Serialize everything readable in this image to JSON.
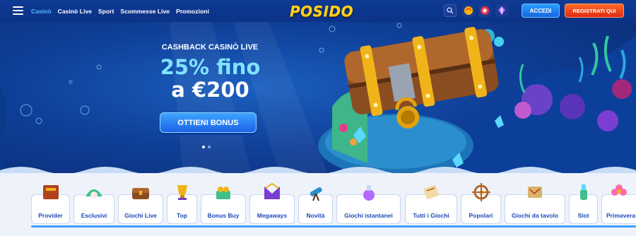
{
  "nav": {
    "menu_icon": "hamburger-menu-icon",
    "items": [
      {
        "label": "Casinò",
        "active": true
      },
      {
        "label": "Casinò Live",
        "active": false
      },
      {
        "label": "Sport",
        "active": false
      },
      {
        "label": "Scommesse Live",
        "active": false
      },
      {
        "label": "Promozioni",
        "active": false
      }
    ]
  },
  "logo": "POSIDO",
  "header": {
    "search_icon": "search-icon",
    "login_label": "ACCEDI",
    "register_label": "REGISTRATI QUI"
  },
  "hero": {
    "subtitle": "CASHBACK CASINÒ LIVE",
    "title_line1": "25% fino",
    "title_line2": "a €200",
    "cta_label": "OTTIENI BONUS",
    "slides": 2,
    "active_slide": 1
  },
  "categories": [
    {
      "label": "Provider",
      "icon": "book-icon"
    },
    {
      "label": "Esclusivi",
      "icon": "shell-pearl-icon"
    },
    {
      "label": "Giochi Live",
      "icon": "chest-icon"
    },
    {
      "label": "Top",
      "icon": "trophy-icon"
    },
    {
      "label": "Bonus Buy",
      "icon": "treasure-icon"
    },
    {
      "label": "Megaways",
      "icon": "m-crown-icon"
    },
    {
      "label": "Novità",
      "icon": "telescope-icon"
    },
    {
      "label": "Giochi istantanei",
      "icon": "potion-icon"
    },
    {
      "label": "Tutti i Giochi",
      "icon": "scroll-icon"
    },
    {
      "label": "Popolari",
      "icon": "ship-wheel-icon"
    },
    {
      "label": "Giochi da tavolo",
      "icon": "map-book-icon"
    },
    {
      "label": "Slot",
      "icon": "bottle-icon"
    },
    {
      "label": "Primavera",
      "icon": "flower-icon"
    }
  ],
  "colors": {
    "header_bg": "#0b3286",
    "accent_blue": "#1766e0",
    "accent_orange": "#e02a14",
    "logo_yellow": "#ffd21a",
    "active_nav": "#5ab4ff",
    "category_text": "#1c4ab7"
  }
}
